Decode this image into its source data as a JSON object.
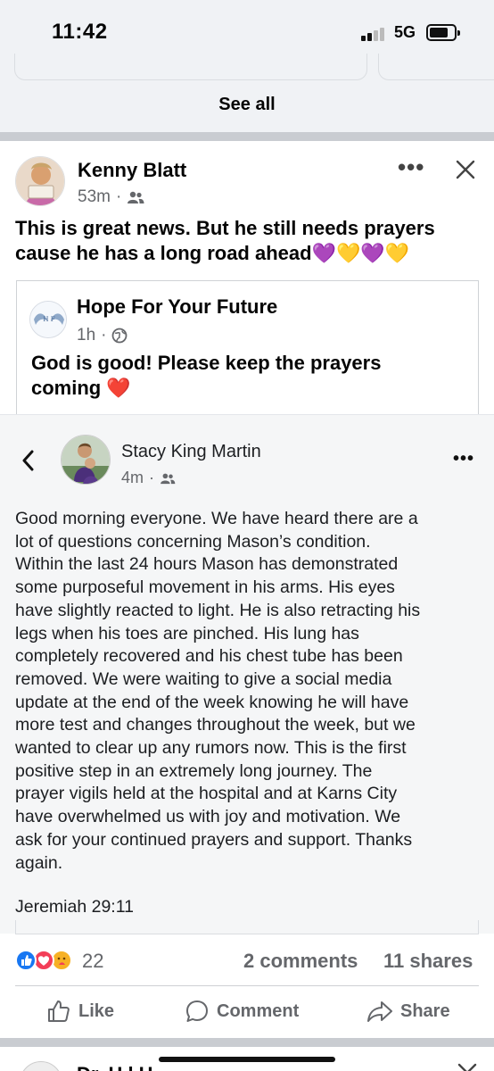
{
  "status_bar": {
    "time": "11:42",
    "network": "5G"
  },
  "feed": {
    "see_all_label": "See all"
  },
  "post": {
    "author": "Kenny Blatt",
    "time": "53m",
    "audience_icon": "friends-icon",
    "text": "This is great news. But he still needs prayers cause he has a long road ahead💜💛💜💛",
    "shared": {
      "page_name": "Hope For Your Future",
      "time": "1h",
      "audience_icon": "globe-icon",
      "text": "God is good! Please keep the prayers coming ❤️"
    },
    "inner_post": {
      "author": "Stacy King Martin",
      "time": "4m",
      "audience_icon": "friends-icon",
      "body": "Good morning everyone.  We have heard there are a\nlot of questions concerning Mason’s condition.\nWithin the last 24 hours Mason has demonstrated\nsome purposeful movement in his arms.  His eyes\nhave slightly reacted to light.  He is also retracting his\nlegs when his toes are pinched.  His lung has\ncompletely recovered and his chest tube has been\nremoved.  We were waiting to give a social media\nupdate at the end of the week knowing he will have\nmore test and changes throughout the week, but we\nwanted to clear up any rumors now.  This is the first\npositive step in an extremely long journey.  The\nprayer vigils held at the hospital and at Karns City\nhave overwhelmed us with joy and motivation.  We\nask for your continued prayers and support.  Thanks\nagain.",
      "verse": "Jeremiah 29:11"
    },
    "reactions": {
      "types": [
        "like",
        "love",
        "care"
      ],
      "count": "22",
      "comments": "2 comments",
      "shares": "11 shares"
    },
    "actions": {
      "like": "Like",
      "comment": "Comment",
      "share": "Share"
    }
  },
  "next_post": {
    "author_partial": "Dr. H   l  H  "
  },
  "colors": {
    "feed_bg": "#f0f2f5",
    "divider": "#c9ccd1",
    "secondary_text": "#65676b",
    "like_blue": "#1877f2",
    "love_red": "#f33e58",
    "care_yellow": "#f7b125"
  }
}
